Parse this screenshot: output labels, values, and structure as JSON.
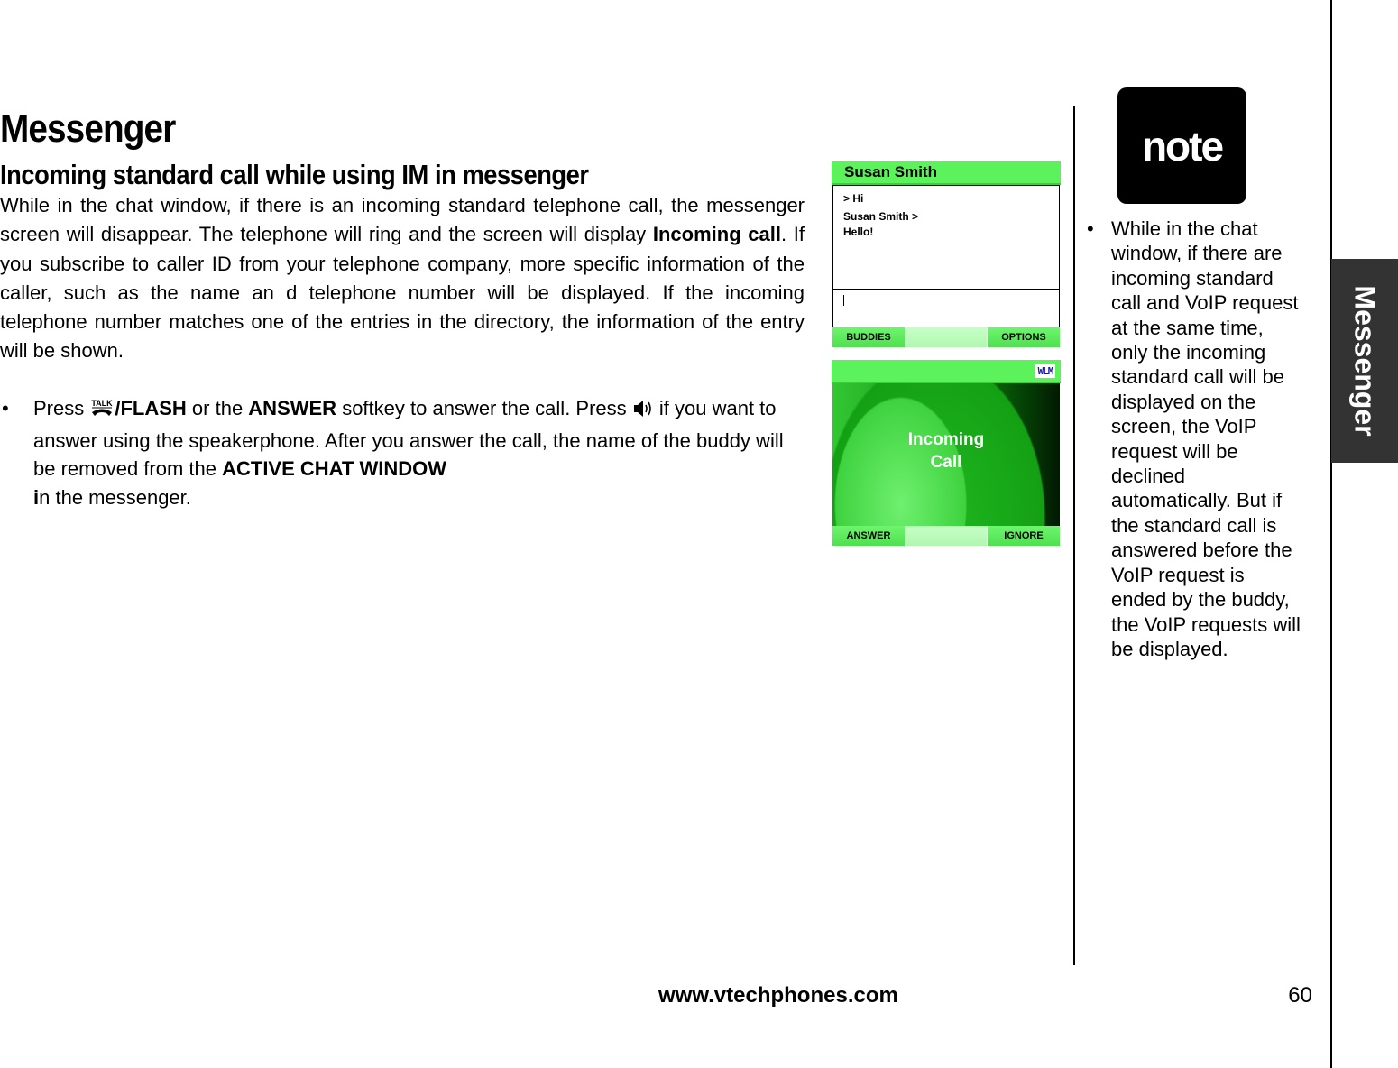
{
  "page": {
    "title": "Messenger",
    "section_title": "Incoming standard call while using IM in messenger",
    "intro": {
      "part1": "While in the chat window, if there is an incoming standard telephone call, the messenger screen will disappear. The telephone will ring and the screen will display ",
      "bold1": "Incoming call",
      "part2": ". If you subscribe to caller ID from your telephone company, more specific information of the caller, such as the name an        d telephone number will be displayed. If the incoming telephone number matches one of the entries in the directory, the information of the entry will be shown."
    },
    "bullets": [
      {
        "marker": "•",
        "t1": "Press ",
        "icon": "talk-icon",
        "icon_label": "TALK",
        "b1": "/FLASH",
        "t2": " or the ",
        "b2": "ANSWER",
        "t3": " softkey to answer the call. Press ",
        "icon2": "speaker-icon",
        "t4": " if you want to answer using the speakerphone. After you answer the call, the name of the buddy will be removed from the ",
        "b3": "ACTIVE CHAT WINDOW",
        "b4": "i",
        "t5": "n the messenger."
      }
    ]
  },
  "chat_screen": {
    "contact_name": "Susan Smith",
    "messages": [
      "> Hi",
      "Susan Smith >",
      "Hello!"
    ],
    "input_value": "",
    "softkeys": {
      "left": "BUDDIES",
      "right": "OPTIONS"
    }
  },
  "call_screen": {
    "badge": "WLM",
    "message_line1": "Incoming",
    "message_line2": "Call",
    "softkeys": {
      "left": "ANSWER",
      "right": "IGNORE"
    }
  },
  "note": {
    "badge_label": "note",
    "marker": "•",
    "items": [
      "While in the chat window, if there are incoming standard call and VoIP request at the same time, only the incoming standard call will be displayed on the screen, the VoIP request will be declined automatically. But if the standard call is answered before the VoIP request is ended by the buddy, the VoIP requests will be displayed."
    ]
  },
  "side_tab": {
    "label": "Messenger"
  },
  "footer": {
    "url": "www.vtechphones.com",
    "page_number": "60"
  },
  "colors": {
    "screen_green": "#5cf25c",
    "softkey_mid": "#c7ffc7",
    "tab_dark": "#333333",
    "wlm_blue": "#1a1aa8"
  }
}
